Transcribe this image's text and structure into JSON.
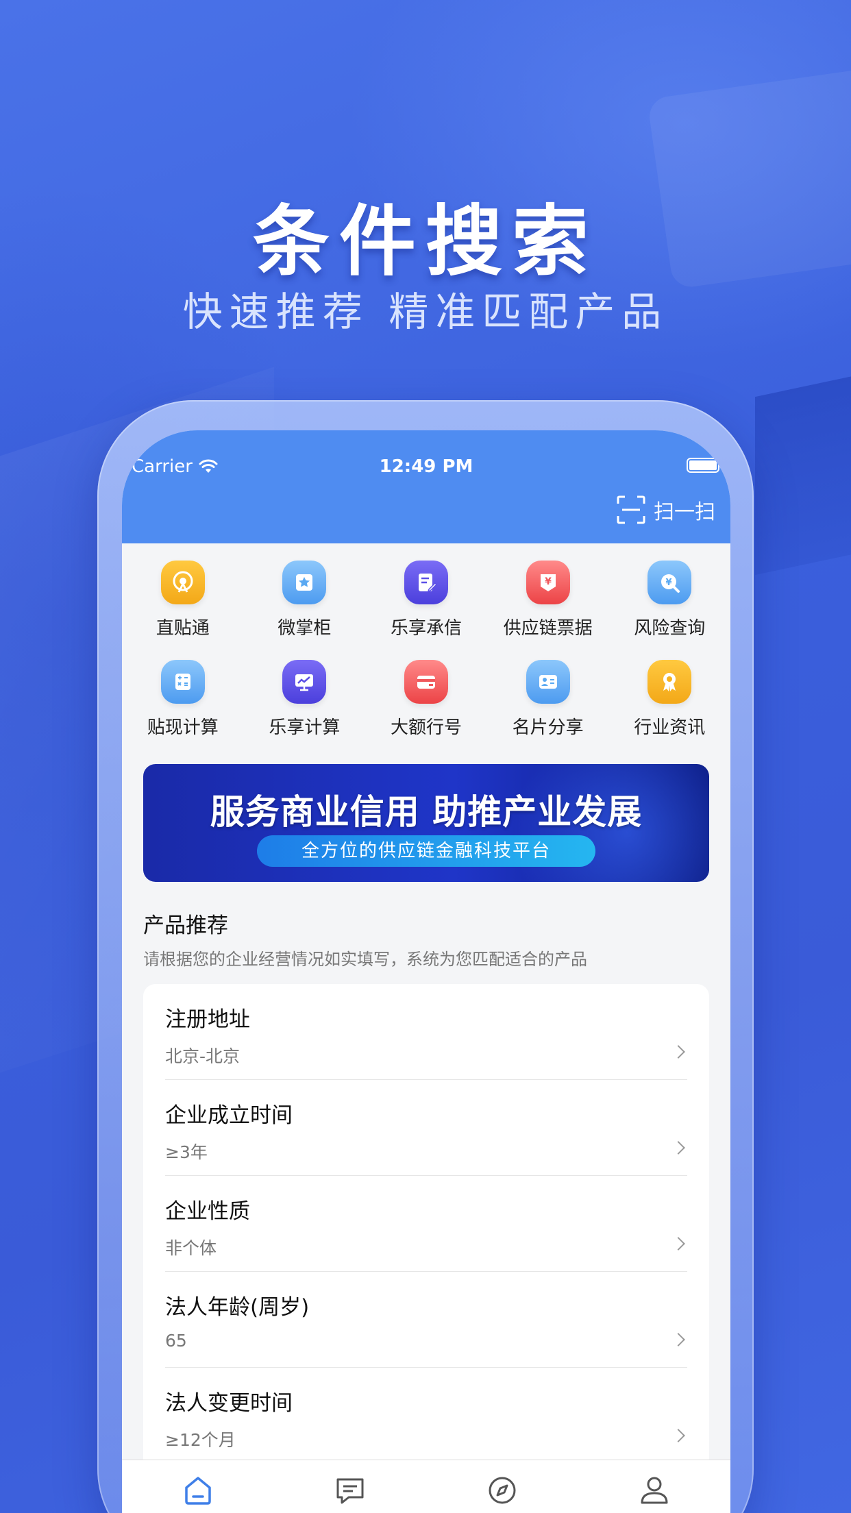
{
  "promo": {
    "headline": "条件搜索",
    "subline": "快速推荐 精准匹配产品"
  },
  "status_bar": {
    "carrier": "Carrier",
    "time": "12:49 PM"
  },
  "header": {
    "scan_label": "扫一扫"
  },
  "quick_menu": [
    {
      "label": "直贴通",
      "icon": "signal-icon",
      "color": "#f5b321"
    },
    {
      "label": "微掌柜",
      "icon": "store-icon",
      "color": "#5aa9f2"
    },
    {
      "label": "乐享承信",
      "icon": "edit-document-icon",
      "color": "#5b4fe6"
    },
    {
      "label": "供应链票据",
      "icon": "yuan-ticket-icon",
      "color": "#f0585c"
    },
    {
      "label": "风险查询",
      "icon": "yuan-search-icon",
      "color": "#5aa9f2"
    },
    {
      "label": "贴现计算",
      "icon": "calculator-icon",
      "color": "#5aa9f2"
    },
    {
      "label": "乐享计算",
      "icon": "trend-chart-icon",
      "color": "#5b4fe6"
    },
    {
      "label": "大额行号",
      "icon": "card-icon",
      "color": "#f0585c"
    },
    {
      "label": "名片分享",
      "icon": "contact-card-icon",
      "color": "#5aa9f2"
    },
    {
      "label": "行业资讯",
      "icon": "award-icon",
      "color": "#f5b321"
    }
  ],
  "banner": {
    "title": "服务商业信用 助推产业发展",
    "pill": "全方位的供应链金融科技平台"
  },
  "section": {
    "title": "产品推荐",
    "subtitle": "请根据您的企业经营情况如实填写，系统为您匹配适合的产品"
  },
  "form_rows": [
    {
      "label": "注册地址",
      "value": "北京-北京"
    },
    {
      "label": "企业成立时间",
      "value": "≥3年"
    },
    {
      "label": "企业性质",
      "value": "非个体"
    },
    {
      "label": "法人年龄(周岁)",
      "value": "65"
    },
    {
      "label": "法人变更时间",
      "value": "≥12个月"
    }
  ],
  "tabbar": [
    {
      "icon": "home-icon",
      "active": true
    },
    {
      "icon": "message-icon",
      "active": false
    },
    {
      "icon": "compass-icon",
      "active": false
    },
    {
      "icon": "user-icon",
      "active": false
    }
  ],
  "colors": {
    "background": "#3f63e0",
    "header": "#4f8cf1",
    "active_tab": "#3f7fe8"
  }
}
